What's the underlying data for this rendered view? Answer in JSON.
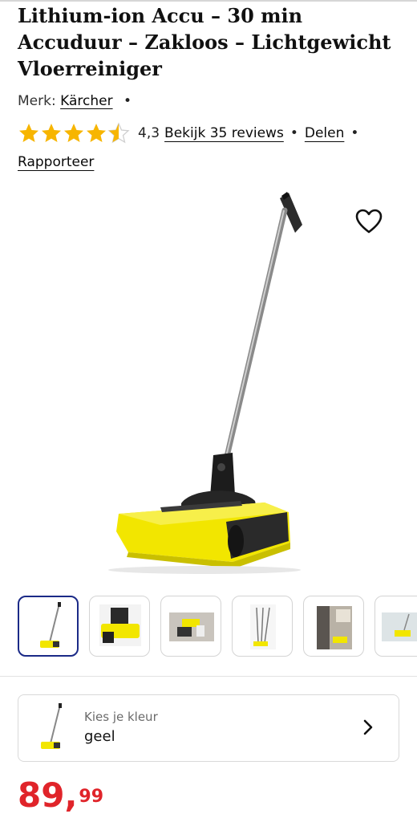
{
  "product": {
    "title": "Lithium-ion Accu – 30 min Accuduur – Zakloos – Lichtgewicht Vloerreiniger",
    "brand_prefix": "Merk:",
    "brand": "Kärcher",
    "rating_value": "4,3",
    "rating_fraction": 0.86,
    "reviews_link": "Bekijk 35 reviews",
    "share_link": "Delen",
    "report_link": "Rapporteer",
    "wishlist_icon": "heart-outline-icon"
  },
  "gallery": {
    "thumbnails": [
      "thumbnail-1",
      "thumbnail-2",
      "thumbnail-3",
      "thumbnail-4",
      "thumbnail-5",
      "thumbnail-6"
    ]
  },
  "color_selector": {
    "label": "Kies je kleur",
    "value": "geel",
    "icon": "chevron-right-icon"
  },
  "price": {
    "euros": "89,",
    "cents": "99"
  },
  "colors": {
    "price_red": "#e0242a",
    "star_yellow": "#f7b500",
    "selected_border": "#1b2a87",
    "product_yellow": "#f2e600"
  }
}
